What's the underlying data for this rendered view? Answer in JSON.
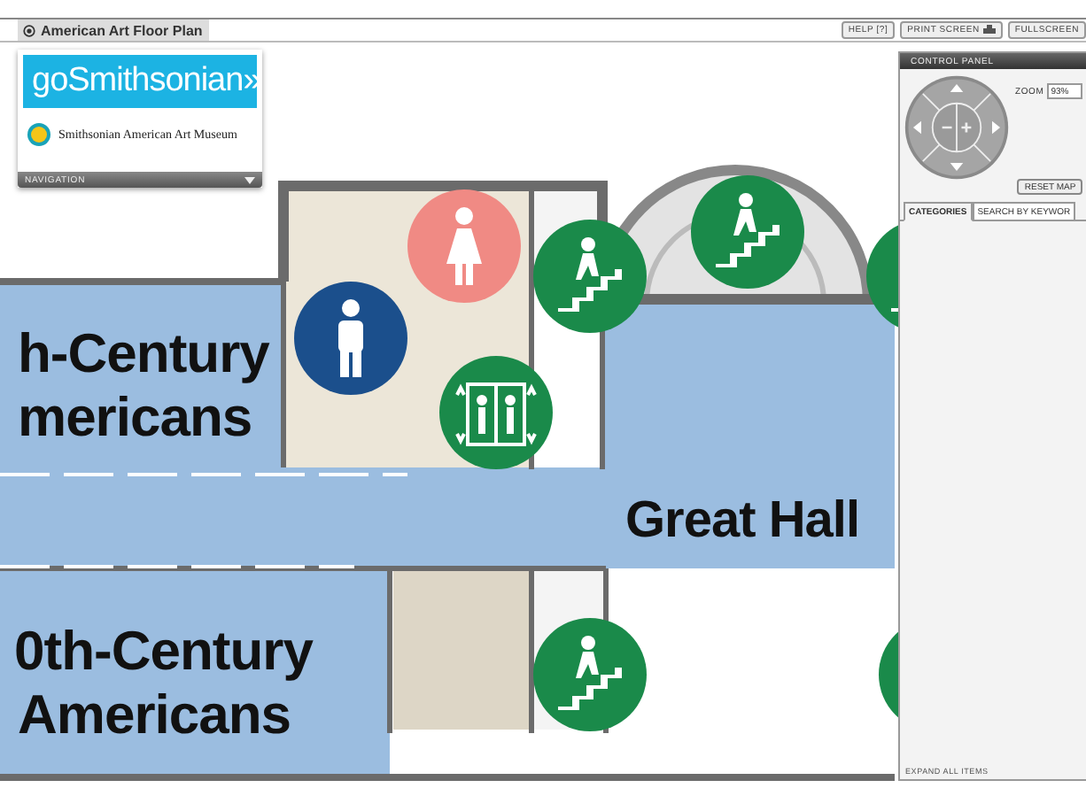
{
  "window": {
    "title": "American Art Floor Plan"
  },
  "toolbar_buttons": [
    {
      "label": "HELP [?]",
      "kind": "text"
    },
    {
      "label": "PRINT SCREEN",
      "kind": "print"
    },
    {
      "label": "FULLSCREEN",
      "kind": "text"
    }
  ],
  "logo_panel": {
    "brand": "goSmithsonian»",
    "museum": "Smithsonian American Art Museum",
    "navigation": "NAVIGATION"
  },
  "room_labels": [
    "h-Century",
    "mericans",
    "Great Hall",
    "0th-Century",
    "Americans"
  ],
  "control_panel": {
    "title": "CONTROL PANEL",
    "zoom_label": "ZOOM",
    "zoom_value": "93%",
    "reset": "RESET MAP",
    "tabs": [
      {
        "label": "CATEGORIES",
        "selected": true
      },
      {
        "label": "SEARCH BY KEYWOR",
        "selected": false
      }
    ],
    "footer": "EXPAND ALL ITEMS"
  }
}
